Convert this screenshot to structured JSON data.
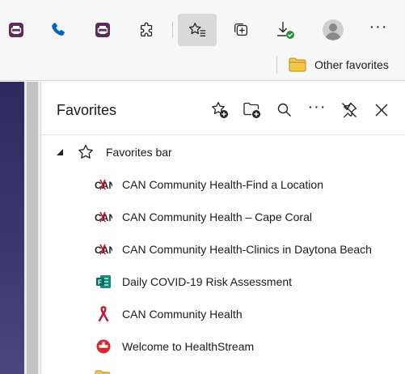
{
  "toolbar": {
    "buttons": [
      {
        "name": "app-icon-1",
        "icon": "printer-app-icon"
      },
      {
        "name": "phone",
        "icon": "phone-icon"
      },
      {
        "name": "app-icon-2",
        "icon": "printer-app-icon"
      },
      {
        "name": "extensions",
        "icon": "puzzle-icon"
      },
      {
        "name": "favorites",
        "icon": "favorites-list-icon",
        "active": true
      },
      {
        "name": "collections",
        "icon": "collections-icon"
      },
      {
        "name": "downloads",
        "icon": "download-icon"
      },
      {
        "name": "profile",
        "icon": "avatar-icon"
      },
      {
        "name": "more",
        "icon": "more-icon",
        "label": "···"
      }
    ]
  },
  "favorites_bar": {
    "other_favorites_label": "Other favorites"
  },
  "panel": {
    "title": "Favorites",
    "header_actions": [
      "add-favorite",
      "add-folder",
      "search",
      "more",
      "unpin",
      "close"
    ],
    "more_label": "···",
    "root": {
      "label": "Favorites bar",
      "expanded": true,
      "items": [
        {
          "label": "CAN Community Health-Find a Location",
          "icon": "can-logo"
        },
        {
          "label": "CAN Community Health – Cape Coral",
          "icon": "can-logo"
        },
        {
          "label": "CAN Community Health-Clinics in Daytona Beach",
          "icon": "can-logo"
        },
        {
          "label": "Daily COVID-19 Risk Assessment",
          "icon": "forms-icon"
        },
        {
          "label": "CAN Community Health",
          "icon": "ribbon-icon"
        },
        {
          "label": "Welcome to HealthStream",
          "icon": "healthstream-icon"
        }
      ]
    },
    "can_logo_text": "CAN"
  },
  "colors": {
    "accent_blue": "#0067c0",
    "app_purple": "#5b2b5a",
    "download_green": "#2e8b3d",
    "folder_yellow": "#f2c94c",
    "can_red": "#c8102e"
  }
}
